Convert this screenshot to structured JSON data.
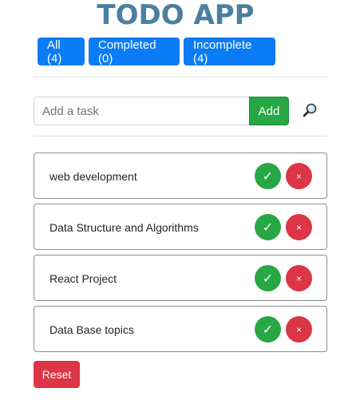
{
  "app": {
    "title": "TODO APP"
  },
  "filters": [
    {
      "label": "All (4)"
    },
    {
      "label": "Completed (0)"
    },
    {
      "label": "Incomplete (4)"
    }
  ],
  "input": {
    "placeholder": "Add a task",
    "value": "",
    "add_label": "Add",
    "search_icon": "magnifier-icon"
  },
  "tasks": [
    {
      "text": "web development",
      "done_icon": "✓",
      "delete_icon": "×"
    },
    {
      "text": "Data Structure and Algorithms",
      "done_icon": "✓",
      "delete_icon": "×"
    },
    {
      "text": "React Project",
      "done_icon": "✓",
      "delete_icon": "×"
    },
    {
      "text": "Data Base topics",
      "done_icon": "✓",
      "delete_icon": "×"
    }
  ],
  "reset_label": "Reset",
  "colors": {
    "title": "#4a7f9f",
    "primary": "#0a7cf5",
    "success": "#28a745",
    "danger": "#dc3545"
  }
}
